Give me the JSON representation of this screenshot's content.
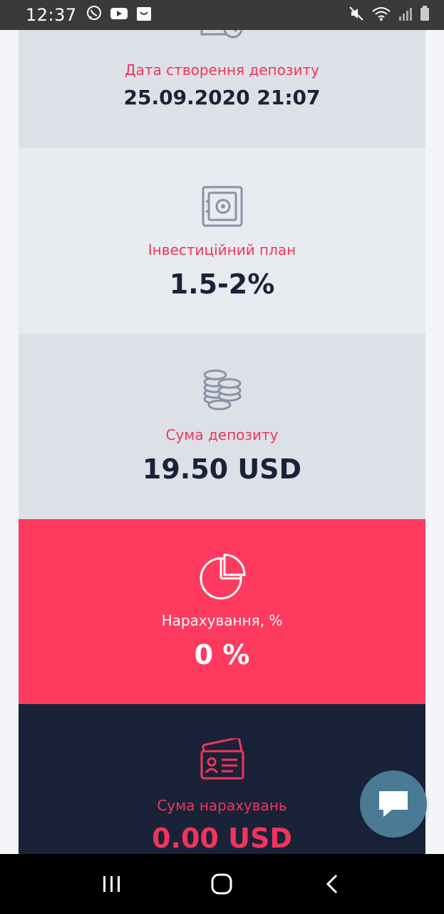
{
  "status_bar": {
    "time": "12:37",
    "left_icons": [
      "viber-icon",
      "youtube-icon",
      "shopping-bag-icon"
    ],
    "right_icons": [
      "mute-icon",
      "wifi-icon",
      "signal-icon",
      "battery-icon"
    ]
  },
  "cards": {
    "date": {
      "icon": "calendar-clock-icon",
      "label": "Дата створення депозиту",
      "value": "25.09.2020 21:07"
    },
    "plan": {
      "icon": "safe-icon",
      "label": "Інвестиційний план",
      "value": "1.5-2%"
    },
    "sum": {
      "icon": "coins-icon",
      "label": "Сума депозиту",
      "value": "19.50 USD"
    },
    "accrual": {
      "icon": "pie-chart-icon",
      "label": "Нарахування, %",
      "value": "0 %"
    },
    "accrual_sum": {
      "icon": "id-card-icon",
      "label": "Сума нарахувань",
      "value": "0.00 USD"
    }
  },
  "chat": {
    "icon": "chat-bubble-icon"
  },
  "nav": {
    "buttons": [
      "recent-apps-icon",
      "home-icon",
      "back-icon"
    ]
  },
  "colors": {
    "accent": "#ff3a5f",
    "label_red": "#f0355c",
    "dark_navy": "#1a2238",
    "card_grey": "#dde1e7",
    "card_light": "#e8ebf0",
    "chat_fab": "#4a7a94"
  }
}
